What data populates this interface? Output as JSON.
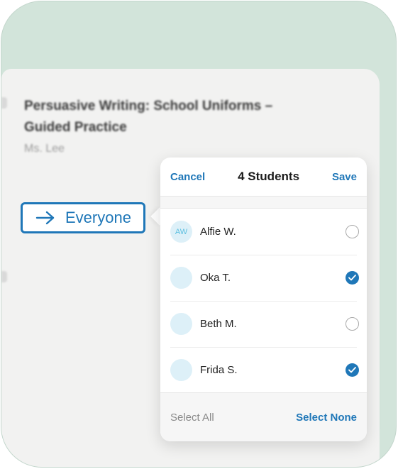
{
  "assignment": {
    "title": "Persuasive Writing: School Uniforms – Guided Practice",
    "teacher": "Ms. Lee"
  },
  "assign_target": {
    "label": "Everyone",
    "icon": "arrow-right-icon"
  },
  "picker": {
    "cancel_label": "Cancel",
    "title": "4 Students",
    "save_label": "Save",
    "students": [
      {
        "initials": "AW",
        "name": "Alfie W.",
        "selected": false
      },
      {
        "initials": "",
        "name": "Oka T.",
        "selected": true
      },
      {
        "initials": "",
        "name": "Beth M.",
        "selected": false
      },
      {
        "initials": "",
        "name": "Frida S.",
        "selected": true
      }
    ],
    "select_all_label": "Select All",
    "select_none_label": "Select None"
  },
  "colors": {
    "accent": "#1f77b8",
    "background": "#d2e4da",
    "avatar_bg": "#ddf0f8"
  }
}
